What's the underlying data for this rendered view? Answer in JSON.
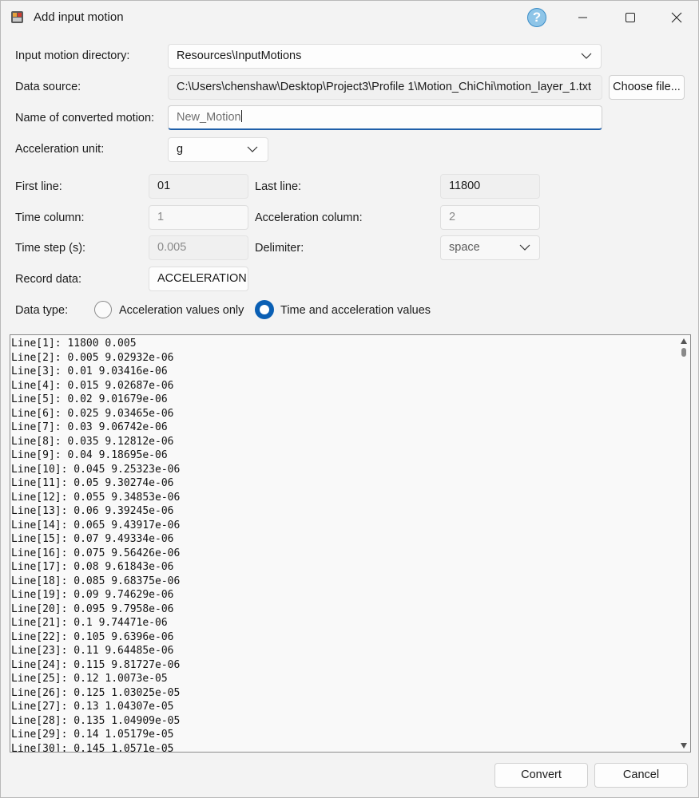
{
  "window": {
    "title": "Add input motion"
  },
  "titlebar": {
    "help_label": "?"
  },
  "form": {
    "input_dir_label": "Input motion directory:",
    "input_dir_value": "Resources\\InputMotions",
    "data_source_label": "Data source:",
    "data_source_value": "C:\\Users\\chenshaw\\Desktop\\Project3\\Profile 1\\Motion_ChiChi\\motion_layer_1.txt",
    "choose_file_label": "Choose file...",
    "name_label": "Name of converted motion:",
    "name_value": "New_Motion",
    "accel_unit_label": "Acceleration unit:",
    "accel_unit_value": "g",
    "first_line_label": "First line:",
    "first_line_value": "01",
    "last_line_label": "Last line:",
    "last_line_value": "11800",
    "time_col_label": "Time column:",
    "time_col_value": "1",
    "accel_col_label": "Acceleration column:",
    "accel_col_value": "2",
    "time_step_label": "Time step (s):",
    "time_step_value": "0.005",
    "delimiter_label": "Delimiter:",
    "delimiter_value": "space",
    "record_label": "Record data:",
    "record_value": "ACCELERATION",
    "data_type_label": "Data type:",
    "radio_accel_only": "Acceleration values only",
    "radio_time_accel": "Time and acceleration values",
    "selected_data_type": "Time and acceleration values"
  },
  "preview_lines": [
    "Line[1]: 11800 0.005",
    "Line[2]: 0.005 9.02932e-06",
    "Line[3]: 0.01 9.03416e-06",
    "Line[4]: 0.015 9.02687e-06",
    "Line[5]: 0.02 9.01679e-06",
    "Line[6]: 0.025 9.03465e-06",
    "Line[7]: 0.03 9.06742e-06",
    "Line[8]: 0.035 9.12812e-06",
    "Line[9]: 0.04 9.18695e-06",
    "Line[10]: 0.045 9.25323e-06",
    "Line[11]: 0.05 9.30274e-06",
    "Line[12]: 0.055 9.34853e-06",
    "Line[13]: 0.06 9.39245e-06",
    "Line[14]: 0.065 9.43917e-06",
    "Line[15]: 0.07 9.49334e-06",
    "Line[16]: 0.075 9.56426e-06",
    "Line[17]: 0.08 9.61843e-06",
    "Line[18]: 0.085 9.68375e-06",
    "Line[19]: 0.09 9.74629e-06",
    "Line[20]: 0.095 9.7958e-06",
    "Line[21]: 0.1 9.74471e-06",
    "Line[22]: 0.105 9.6396e-06",
    "Line[23]: 0.11 9.64485e-06",
    "Line[24]: 0.115 9.81727e-06",
    "Line[25]: 0.12 1.0073e-05",
    "Line[26]: 0.125 1.03025e-05",
    "Line[27]: 0.13 1.04307e-05",
    "Line[28]: 0.135 1.04909e-05",
    "Line[29]: 0.14 1.05179e-05",
    "Line[30]: 0.145 1.0571e-05"
  ],
  "footer": {
    "convert_label": "Convert",
    "cancel_label": "Cancel"
  },
  "colors": {
    "accent": "#0a5fb4",
    "help": "#8ec5e8",
    "background": "#f3f3f3"
  },
  "icons": [
    "app-icon",
    "help-icon",
    "minimize-icon",
    "maximize-icon",
    "close-icon",
    "chevron-down-icon",
    "scroll-up-icon",
    "scroll-down-icon"
  ]
}
